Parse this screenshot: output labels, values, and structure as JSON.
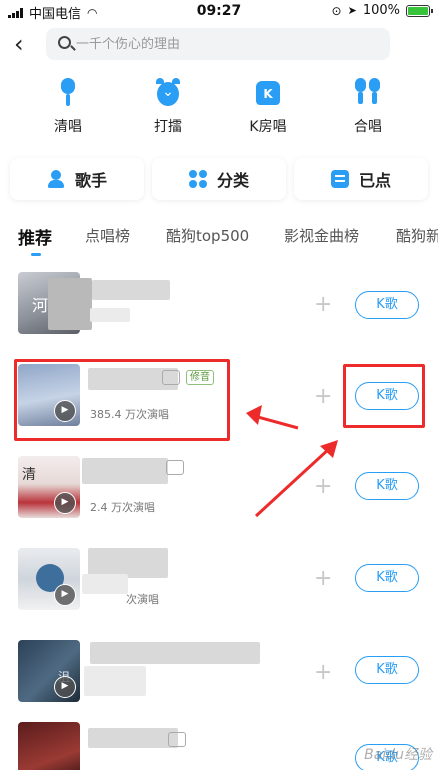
{
  "status_bar": {
    "carrier": "中国电信",
    "time": "09:27",
    "battery": "100%"
  },
  "search": {
    "placeholder": "一千个伤心的理由"
  },
  "features": [
    {
      "label": "清唱",
      "icon": "microphone-icon"
    },
    {
      "label": "打擂",
      "icon": "alarm-clock-icon"
    },
    {
      "label": "K房唱",
      "icon": "k-room-icon"
    },
    {
      "label": "合唱",
      "icon": "duet-microphones-icon"
    }
  ],
  "categories": [
    {
      "label": "歌手",
      "icon": "singer-icon"
    },
    {
      "label": "分类",
      "icon": "category-icon"
    },
    {
      "label": "已点",
      "icon": "selected-list-icon"
    }
  ],
  "tabs": [
    "推荐",
    "点唱榜",
    "酷狗top500",
    "影视金曲榜",
    "酷狗新"
  ],
  "songs": [
    {
      "stat": "",
      "tag": "",
      "button": "K歌"
    },
    {
      "stat": "385.4 万次演唱",
      "tag": "修音",
      "button": "K歌"
    },
    {
      "stat": "2.4 万次演唱",
      "tag": "",
      "button": "K歌"
    },
    {
      "stat": "次演唱",
      "tag": "",
      "button": "K歌"
    },
    {
      "stat": "",
      "tag": "",
      "button": "K歌"
    },
    {
      "stat": "",
      "tag": "",
      "button": "K歌"
    }
  ],
  "cover_texts": [
    "河",
    "清",
    "",
    "",
    "沮"
  ],
  "watermark": "Baidu经验",
  "colors": {
    "accent": "#2a9df4",
    "annotation": "#ee2b2b",
    "tag_green": "#5a9a3f"
  }
}
